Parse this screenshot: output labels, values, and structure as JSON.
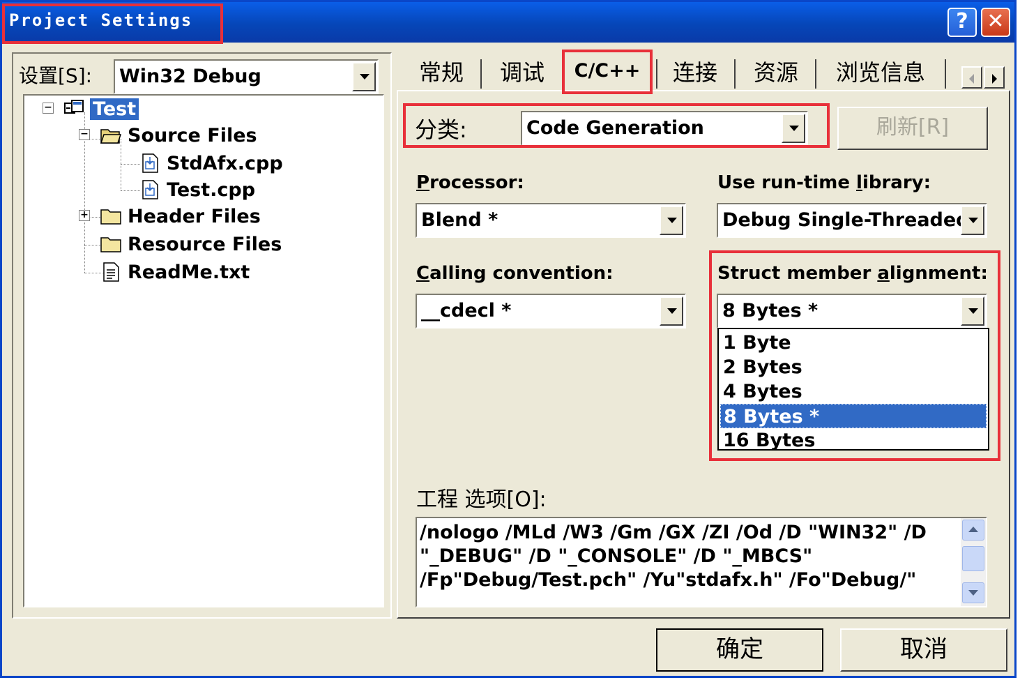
{
  "window": {
    "title": "Project Settings",
    "help_label": "?",
    "close_label": "✕"
  },
  "settings": {
    "label": "设置[S]:",
    "value": "Win32 Debug"
  },
  "tree": {
    "root": "Test",
    "items": [
      {
        "label": "Source Files",
        "icon": "folder-open-icon"
      },
      {
        "label": "StdAfx.cpp",
        "icon": "cpp-file-icon"
      },
      {
        "label": "Test.cpp",
        "icon": "cpp-file-icon"
      },
      {
        "label": "Header Files",
        "icon": "folder-icon"
      },
      {
        "label": "Resource Files",
        "icon": "folder-icon"
      },
      {
        "label": "ReadMe.txt",
        "icon": "text-file-icon"
      }
    ]
  },
  "tabs": [
    {
      "label": "常规"
    },
    {
      "label": "调试"
    },
    {
      "label": "C/C++"
    },
    {
      "label": "连接"
    },
    {
      "label": "资源"
    },
    {
      "label": "浏览信息"
    }
  ],
  "category": {
    "label": "分类:",
    "value": "Code Generation",
    "refresh_label": "刷新[R]"
  },
  "processor": {
    "label_first": "P",
    "label_rest": "rocessor:",
    "value": "Blend *"
  },
  "runtime": {
    "label_a": "Use run-time ",
    "label_u": "l",
    "label_b": "ibrary:",
    "value": "Debug Single-Threaded"
  },
  "calling": {
    "label_first": "C",
    "label_rest": "alling convention:",
    "value": "__cdecl *"
  },
  "alignment": {
    "label_a": "Struct member ",
    "label_u": "a",
    "label_b": "lignment:",
    "value": "8 Bytes *",
    "options": [
      "1 Byte",
      "2 Bytes",
      "4 Bytes",
      "8 Bytes *",
      "16 Bytes"
    ],
    "selected_index": 3
  },
  "project_options": {
    "label": "工程 选项[O]:",
    "text": "/nologo /MLd /W3 /Gm /GX /ZI /Od /D \"WIN32\" /D \"_DEBUG\" /D \"_CONSOLE\" /D \"_MBCS\" /Fp\"Debug/Test.pch\" /Yu\"stdafx.h\" /Fo\"Debug/\""
  },
  "buttons": {
    "ok": "确定",
    "cancel": "取消"
  },
  "colors": {
    "highlight_box": "#e8303a",
    "selection": "#316ac5",
    "titlebar": "#0a46c8"
  }
}
